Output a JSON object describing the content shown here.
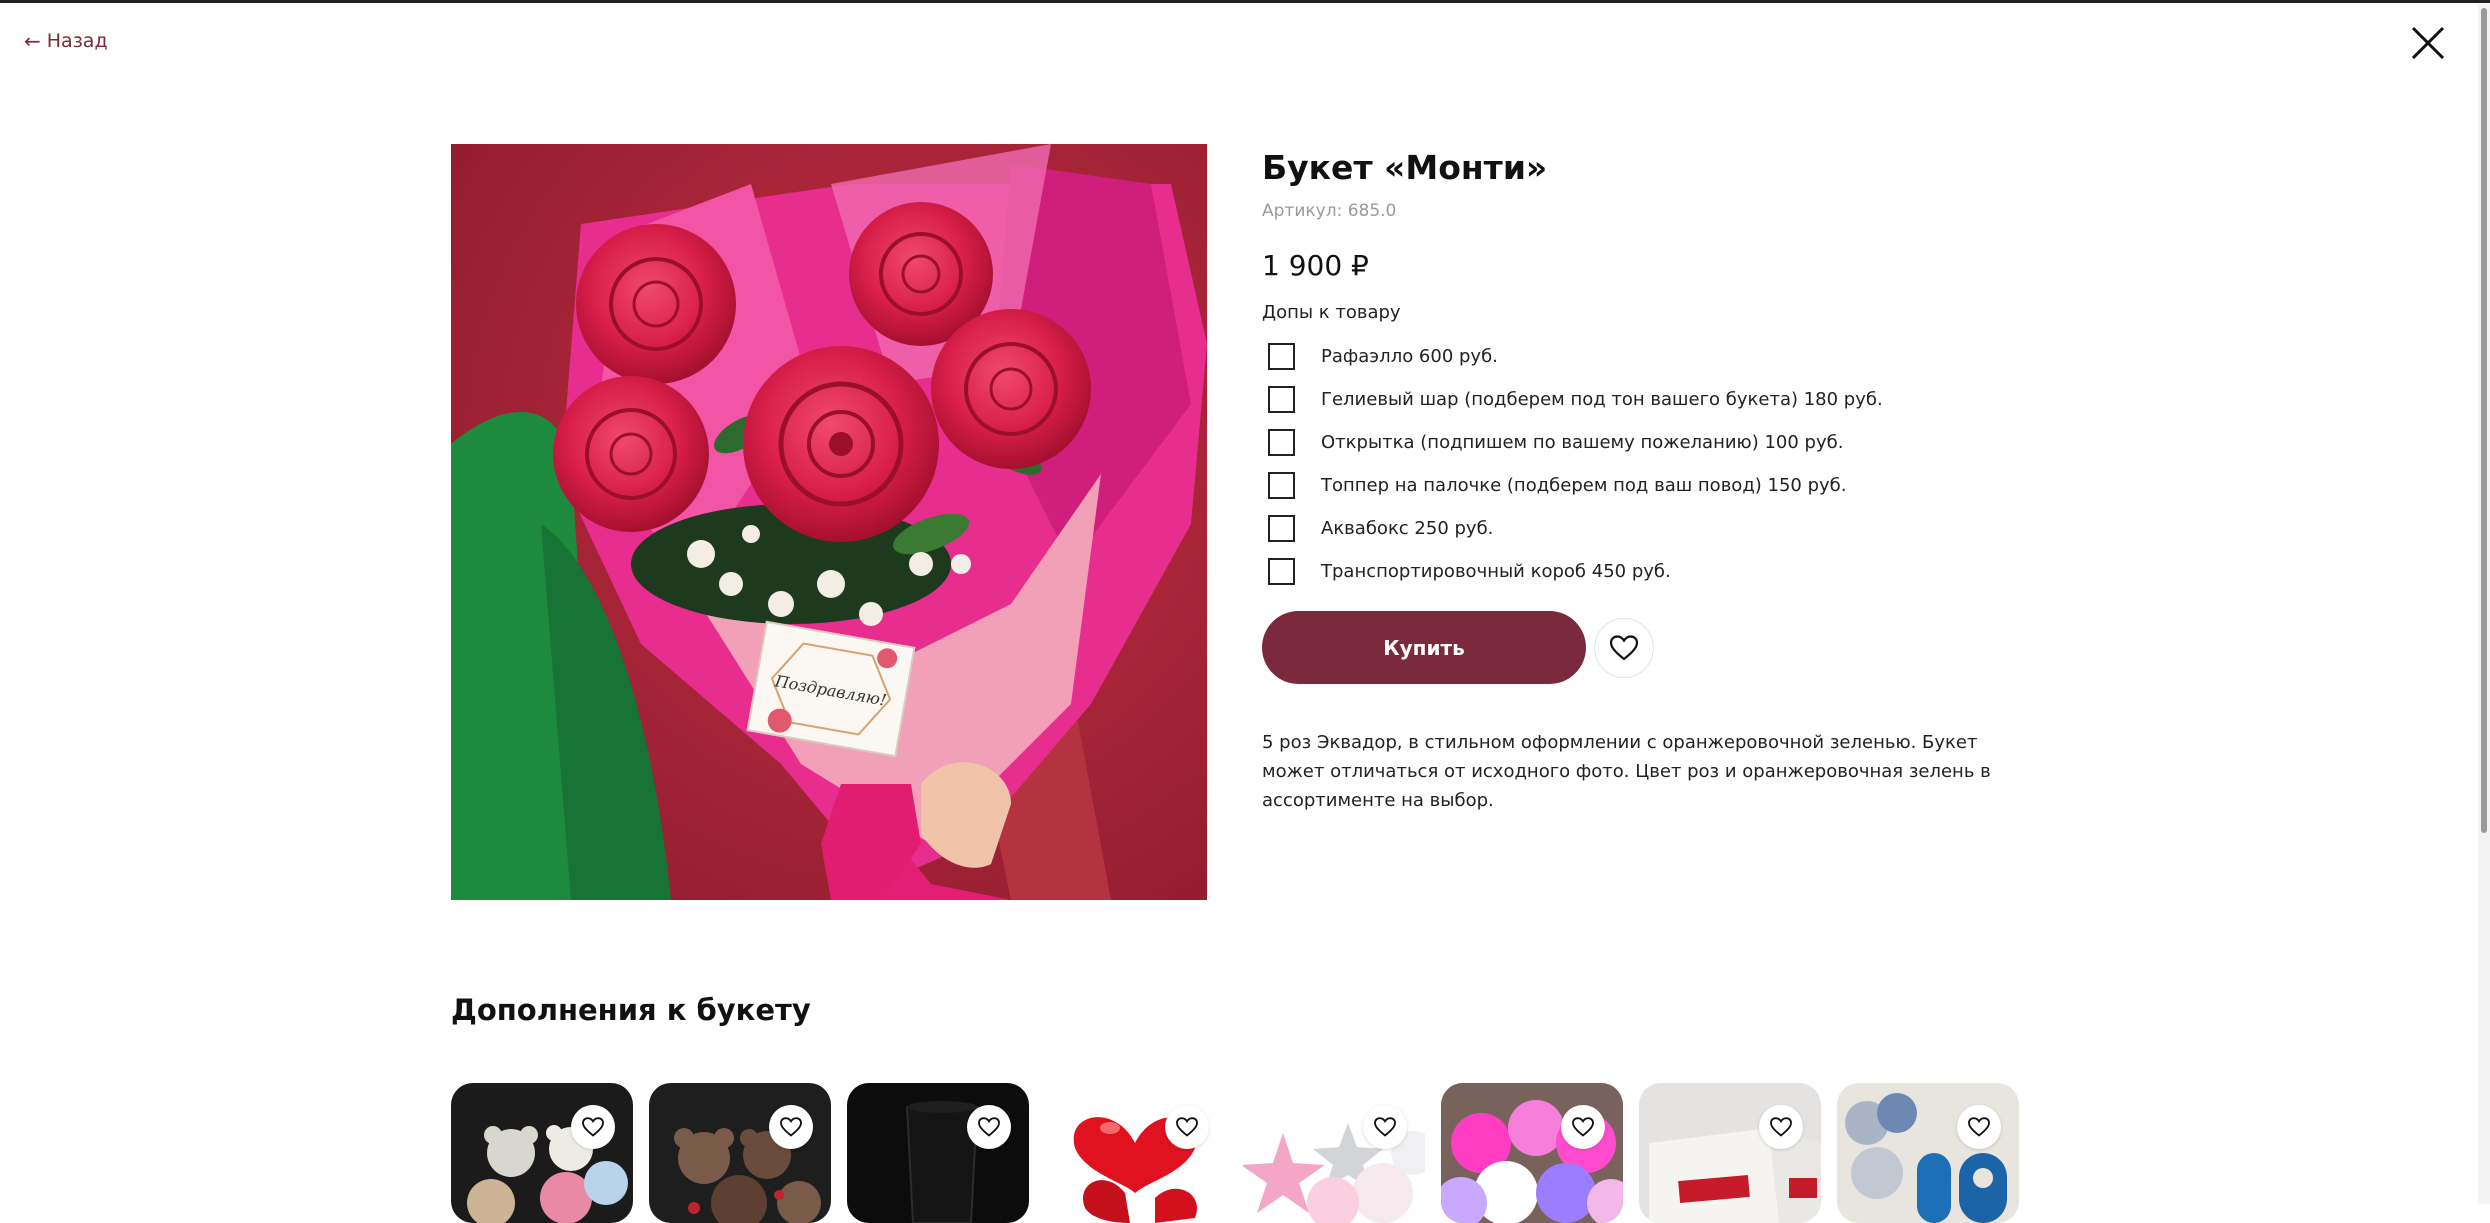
{
  "nav": {
    "back_label": "Назад"
  },
  "product": {
    "title": "Букет «Монти»",
    "sku": "Артикул: 685.0",
    "price": "1 900 ₽",
    "addons_title": "Допы к товару",
    "addons": [
      {
        "label": "Рафаэлло 600 руб.",
        "checked": false
      },
      {
        "label": "Гелиевый шар (подберем под тон вашего букета) 180 руб.",
        "checked": false
      },
      {
        "label": "Открытка (подпишем по вашему пожеланию) 100 руб.",
        "checked": false
      },
      {
        "label": "Топпер на палочке (подберем под ваш повод) 150 руб.",
        "checked": false
      },
      {
        "label": "Аквабокс 250 руб.",
        "checked": false
      },
      {
        "label": "Транспортировочный короб 450 руб.",
        "checked": false
      }
    ],
    "buy_label": "Купить",
    "description": "5 роз Эквадор, в стильном оформлении с оранжеровочной зеленью. Букет может отличаться от исходного фото. Цвет роз и оранжеровочная зелень в ассортименте на выбор.",
    "card_text": "Поздравляю!"
  },
  "extras": {
    "title": "Дополнения к букету",
    "cards": [
      {
        "icon": "teddy-bears-image"
      },
      {
        "icon": "brown-bears-image"
      },
      {
        "icon": "black-vase-image"
      },
      {
        "icon": "red-heart-balloons-image"
      },
      {
        "icon": "pink-star-balloons-image"
      },
      {
        "icon": "balloon-bunch-image"
      },
      {
        "icon": "raffaello-box-image"
      },
      {
        "icon": "number-balloons-image"
      }
    ]
  },
  "colors": {
    "accent": "#7a2a3c",
    "back_link": "#7a2a3a"
  }
}
